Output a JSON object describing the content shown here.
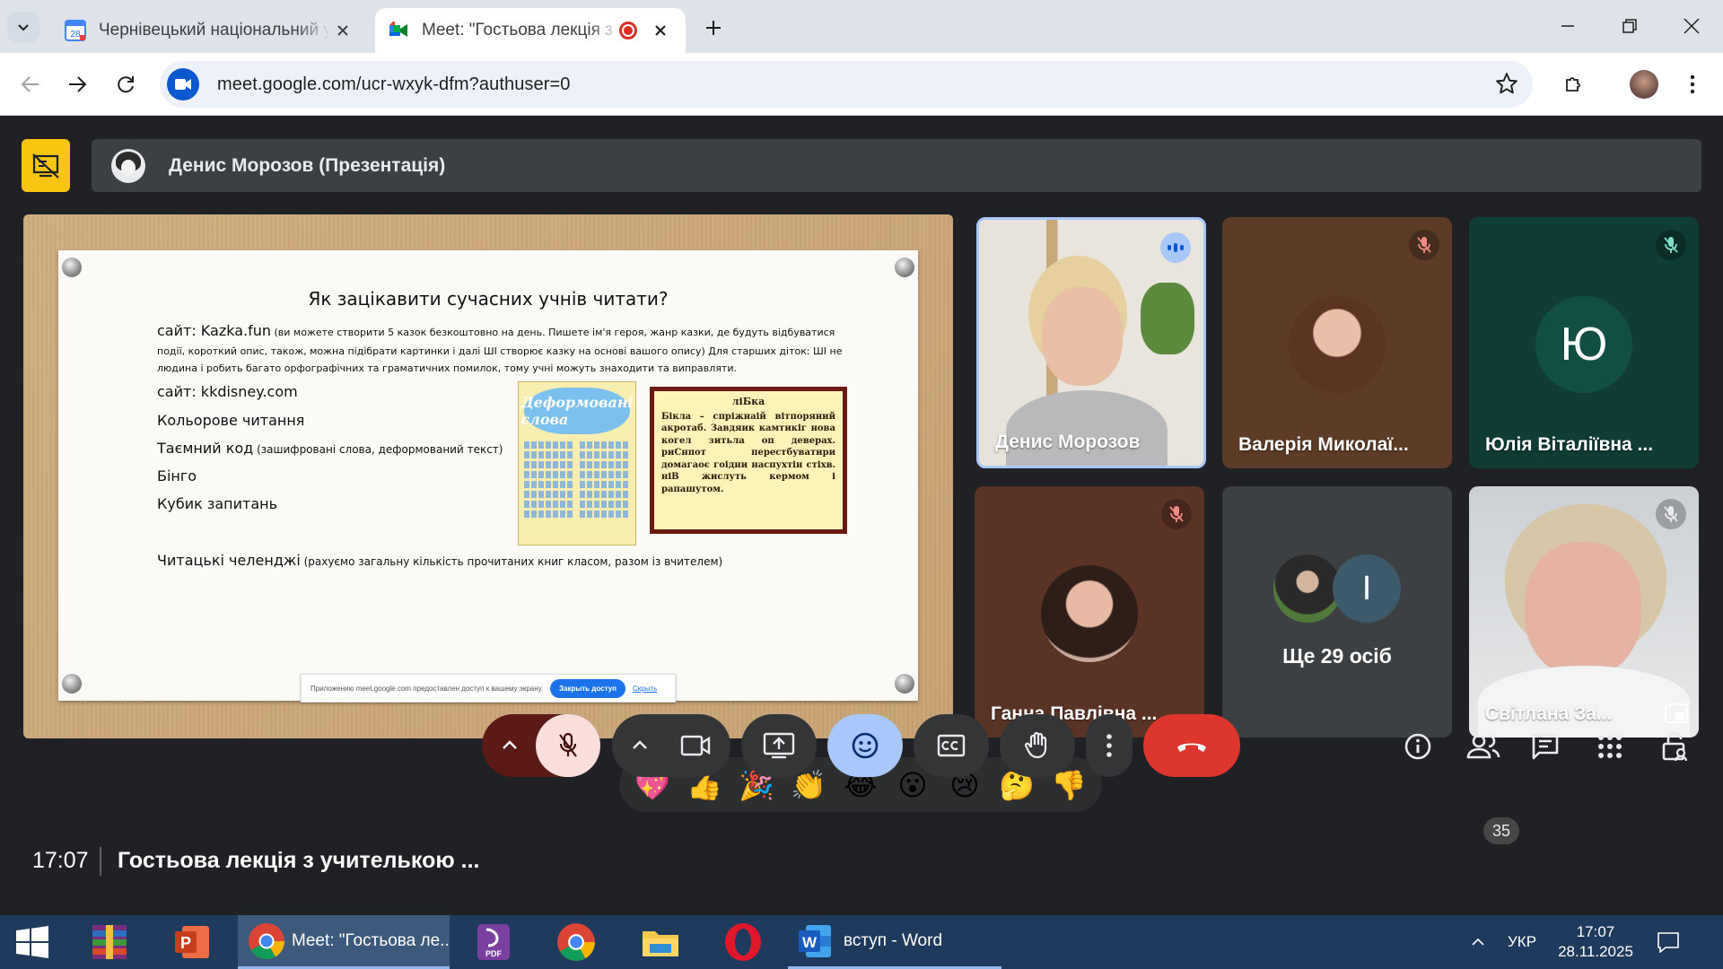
{
  "browser": {
    "tabs": [
      {
        "title": "Чернівецький національний університет",
        "favicon": "calendar-icon"
      },
      {
        "title": "Meet: \"Гостьова лекція з учителькою",
        "favicon": "meet-icon",
        "recording": true
      }
    ],
    "url": "meet.google.com/ucr-wxyk-dfm?authuser=0"
  },
  "meet": {
    "presenter_label": "Денис Морозов (Презентація)",
    "slide": {
      "title": "Як зацікавити сучасних учнів читати?",
      "site1_label": "сайт: Kazka.fun",
      "site1_desc_a": " (ви можете створити 5 казок безкоштовно на день. Пишете ім'я героя, жанр казки, де будуть відбуватися",
      "site1_desc_b": "події, короткий опис, також, можна підібрати картинки і далі ШІ створює казку на основі вашого опису) Для старших діток: ШІ не",
      "site1_desc_c": "людина і робить багато орфографічних та граматичних помилок, тому учні можуть знаходити та виправляти.",
      "site2": "сайт: kkdisney.com",
      "item1": "Кольорове читання",
      "item2_label": "Таємний код",
      "item2_desc": " (зашифровані слова, деформований текст)",
      "item3": "Бінго",
      "item4": "Кубик запитань",
      "item5_label": "Читацькі челенджі",
      "item5_desc": " (рахуємо загальну кількість прочитаних книг класом, разом із вчителем)",
      "words_image_title": "Деформовані слова",
      "card_title": "ліБка",
      "card_text": "Бікла – спріжнаій вітпоряний акротаб. Завдяик камтикіг нова когел зитьла оп деверах. риСнпот перестбуватири домагаоє гоідни наспухтін стіхв. ніВ жислуть кермом і рапашутом.",
      "share_banner": "Приложению meet.google.com предоставлен доступ к вашему экрану.",
      "share_stop": "Закрыть доступ",
      "share_hide": "Скрыть"
    },
    "participants": [
      {
        "name": "Денис Морозов",
        "speaking": true
      },
      {
        "name": "Валерія Миколаї...",
        "muted": true
      },
      {
        "name": "Юлія Віталіївна ...",
        "initial": "Ю",
        "muted": true
      },
      {
        "name": "Ганна Павлівна ...",
        "muted": true
      },
      {
        "name": "Ще 29 осіб",
        "extra_initial": "І"
      },
      {
        "name": "Світлана За...",
        "muted": true
      }
    ],
    "reactions": [
      "💖",
      "👍",
      "🎉",
      "👏",
      "😂",
      "😮",
      "😢",
      "🤔",
      "👎"
    ],
    "time": "17:07",
    "meeting_title": "Гостьова лекція з учителькою ...",
    "people_count": "35"
  },
  "taskbar": {
    "apps": [
      {
        "label": "Meet: \"Гостьова ле...",
        "icon": "chrome-icon"
      },
      {
        "label": "вступ - Word",
        "icon": "word-icon"
      }
    ],
    "lang": "УКР",
    "time": "17:07",
    "date": "28.11.2025"
  }
}
